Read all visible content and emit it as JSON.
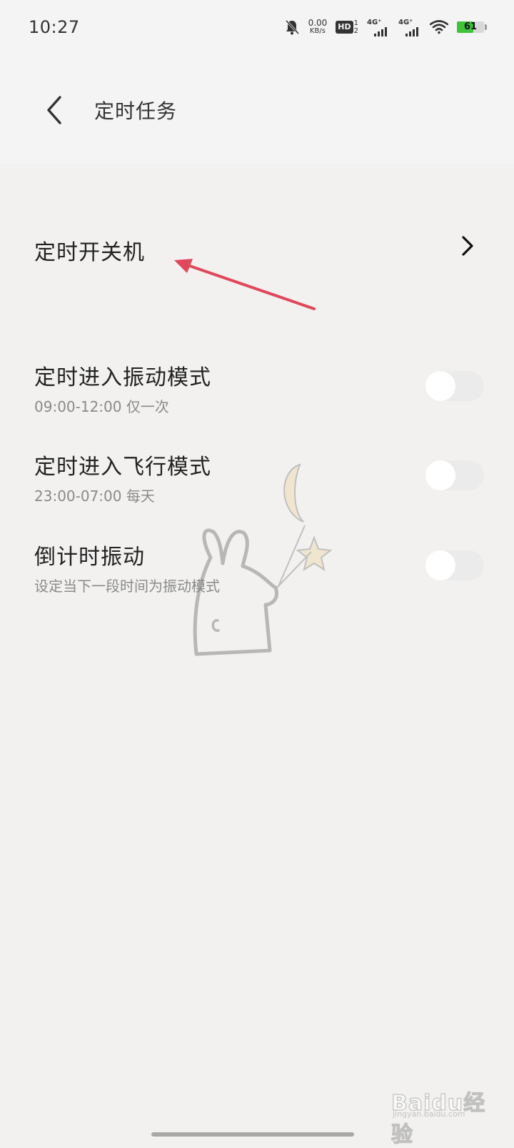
{
  "status_bar": {
    "time": "10:27",
    "net_speed_value": "0.00",
    "net_speed_unit": "KB/s",
    "hd_label": "HD",
    "hd_sim_top": "1",
    "hd_sim_bottom": "2",
    "sim1_label": "4G⁺",
    "sim2_label": "4G⁺",
    "battery_level": "61",
    "battery_fraction": 0.61,
    "icons": [
      "mute-bell-icon",
      "wifi-icon",
      "battery-icon"
    ]
  },
  "header": {
    "title": "定时任务",
    "back_icon": "back-chevron-icon"
  },
  "list": {
    "nav_item": {
      "label": "定时开关机",
      "icon": "chevron-right-icon"
    },
    "toggle_items": [
      {
        "label": "定时进入振动模式",
        "subtitle": "09:00-12:00 仅一次",
        "enabled": false
      },
      {
        "label": "定时进入飞行模式",
        "subtitle": "23:00-07:00 每天",
        "enabled": false
      },
      {
        "label": "倒计时振动",
        "subtitle": "设定当下一段时间为振动模式",
        "enabled": false
      }
    ]
  },
  "annotation": {
    "arrow_color": "#e0475a"
  },
  "watermark": {
    "brand_text": "Baidu经验",
    "brand_url": "jingyan.baidu.com"
  },
  "colors": {
    "background": "#f2f1f0",
    "switch_track": "#ebebeb",
    "battery_green": "#3fc23a"
  }
}
